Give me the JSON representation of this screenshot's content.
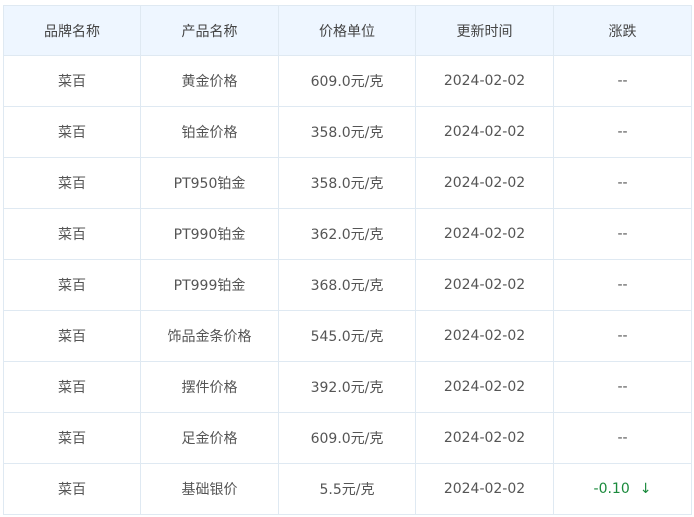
{
  "table": {
    "headers": [
      "品牌名称",
      "产品名称",
      "价格单位",
      "更新时间",
      "涨跌"
    ],
    "rows": [
      {
        "brand": "菜百",
        "product": "黄金价格",
        "price": "609.0元/克",
        "date": "2024-02-02",
        "change": "--"
      },
      {
        "brand": "菜百",
        "product": "铂金价格",
        "price": "358.0元/克",
        "date": "2024-02-02",
        "change": "--"
      },
      {
        "brand": "菜百",
        "product": "PT950铂金",
        "price": "358.0元/克",
        "date": "2024-02-02",
        "change": "--"
      },
      {
        "brand": "菜百",
        "product": "PT990铂金",
        "price": "362.0元/克",
        "date": "2024-02-02",
        "change": "--"
      },
      {
        "brand": "菜百",
        "product": "PT999铂金",
        "price": "368.0元/克",
        "date": "2024-02-02",
        "change": "--"
      },
      {
        "brand": "菜百",
        "product": "饰品金条价格",
        "price": "545.0元/克",
        "date": "2024-02-02",
        "change": "--"
      },
      {
        "brand": "菜百",
        "product": "摆件价格",
        "price": "392.0元/克",
        "date": "2024-02-02",
        "change": "--"
      },
      {
        "brand": "菜百",
        "product": "足金价格",
        "price": "609.0元/克",
        "date": "2024-02-02",
        "change": "--"
      },
      {
        "brand": "菜百",
        "product": "基础银价",
        "price": "5.5元/克",
        "date": "2024-02-02",
        "change": "-0.10",
        "trend_icon": "arrow-down-icon",
        "arrow": "↓"
      }
    ]
  },
  "colors": {
    "header_bg": "#eef6ff",
    "border": "#dfe9f2",
    "down": "#1a8a3c"
  }
}
